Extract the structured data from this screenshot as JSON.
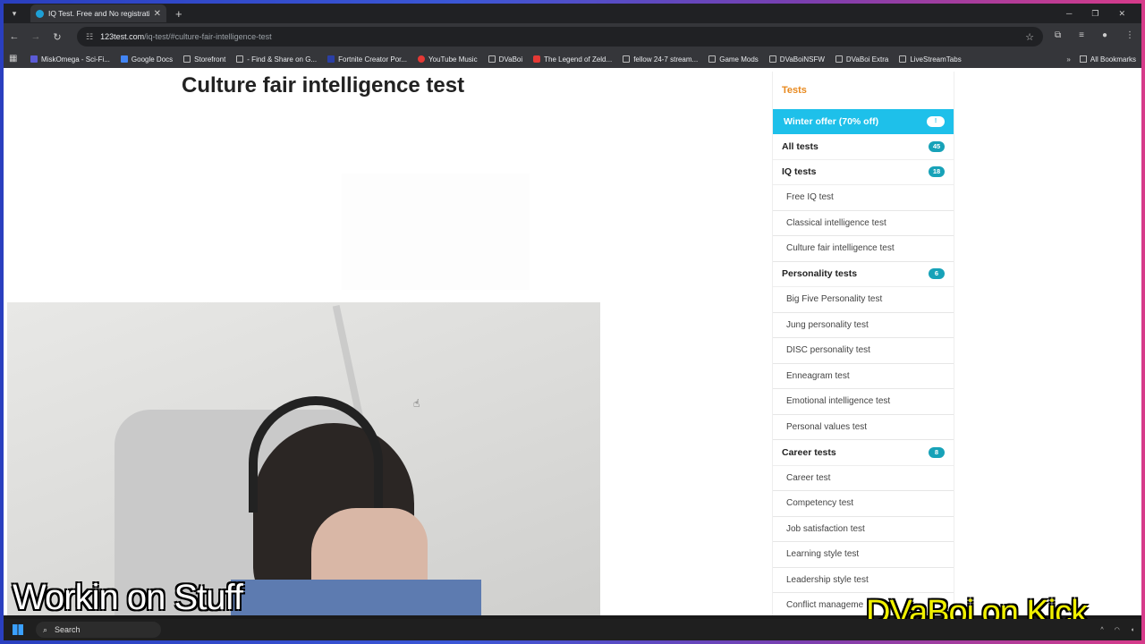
{
  "browser": {
    "tab_title": "IQ Test. Free and No registration",
    "tab_close": "✕",
    "new_tab": "+",
    "url_host": "123test.com",
    "url_path": "/iq-test/#culture-fair-intelligence-test"
  },
  "bookmarks": {
    "items": [
      "MiskOmega - Sci-Fi...",
      "Google Docs",
      "Storefront",
      "- Find & Share on G...",
      "Fortnite Creator Por...",
      "YouTube Music",
      "DVaBoi",
      "The Legend of Zeld...",
      "fellow 24-7 stream...",
      "Game Mods",
      "DVaBoiNSFW",
      "DVaBoi Extra",
      "LiveStreamTabs"
    ],
    "more": "»",
    "all_bookmarks": "All Bookmarks"
  },
  "page": {
    "title": "Culture fair intelligence test"
  },
  "sidebar": {
    "header": "Tests",
    "offer": {
      "label": "Winter offer (70% off)",
      "badge": "!"
    },
    "all_tests": {
      "label": "All tests",
      "count": "45"
    },
    "iq": {
      "label": "IQ tests",
      "count": "18"
    },
    "iq_items": [
      "Free IQ test",
      "Classical intelligence test",
      "Culture fair intelligence test"
    ],
    "personality": {
      "label": "Personality tests",
      "count": "6"
    },
    "personality_items": [
      "Big Five Personality test",
      "Jung personality test",
      "DISC personality test",
      "Enneagram test",
      "Emotional intelligence test",
      "Personal values test"
    ],
    "career": {
      "label": "Career tests",
      "count": "8"
    },
    "career_items": [
      "Career test",
      "Competency test",
      "Job satisfaction test",
      "Learning style test",
      "Leadership style test",
      "Conflict manageme"
    ]
  },
  "overlay": {
    "left_text": "Workin on Stuff",
    "right_text": "DVaBoi on Kick"
  },
  "taskbar": {
    "search": "Search"
  },
  "colors": {
    "accent": "#1ec0ea",
    "badge": "#17a2b8",
    "header_orange": "#e8891e"
  }
}
